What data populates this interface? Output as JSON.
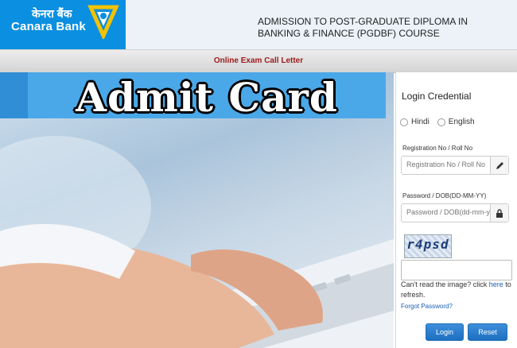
{
  "header": {
    "logo_hindi": "केनरा बैंक",
    "logo_english": "Canara Bank",
    "title": "ADMISSION TO POST-GRADUATE DIPLOMA IN BANKING & FINANCE (PGDBF) COURSE",
    "brand_color": "#0b8fe0"
  },
  "subheader": {
    "text": "Online Exam Call Letter",
    "color": "#9b1b1b"
  },
  "hero": {
    "banner_text": "Admit Card"
  },
  "login": {
    "title": "Login Credential",
    "languages": [
      "Hindi",
      "English"
    ],
    "registration": {
      "label": "Registration No / Roll No",
      "placeholder": "Registration No / Roll No",
      "icon": "pencil-icon"
    },
    "password": {
      "label": "Password / DOB(DD-MM-YY)",
      "placeholder": "Password / DOB(dd-mm-yy)",
      "icon": "lock-icon"
    },
    "captcha_text": "r4psd",
    "hint_prefix": "Can't read the image? click ",
    "hint_link": "here",
    "hint_suffix": " to refresh.",
    "forgot": "Forgot Password?",
    "login_button": "Login",
    "reset_button": "Reset"
  }
}
